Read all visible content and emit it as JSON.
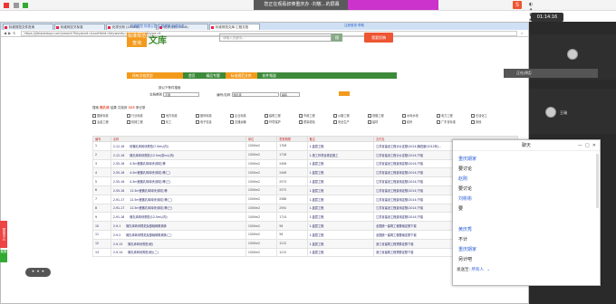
{
  "meeting": {
    "banner": "您正在观看叔俸重庆办 -刘敬...的屏幕",
    "timer": "01:14:16",
    "share_label": "演讲者视图",
    "speaking_label": "正在讲话:",
    "participants": [
      "任俊瑞",
      "王瑞"
    ]
  },
  "browser": {
    "tabs": [
      "标准规范文件查询",
      "标准网交叉标准",
      "化学分析 (2018年)",
      "化学分析 (2018)",
      "标准规范文库:工程文档"
    ],
    "url": "https://jibiaobiaoyi.com/search?Keyword=&sortfield=Keywords=kuanzhanzai&type=6",
    "site": {
      "logo_top": "标准规范",
      "logo_bottom": "查询",
      "logo_word": "文库",
      "search_placeholder": "请输入关键词...",
      "search_btn": "搜",
      "upload_btn": "我要投稿",
      "top_links": "标准规范  标准公告  工程规范  标准动态",
      "right_links": "注册登录  帮助",
      "nav": [
        "所有文档类型",
        "首页",
        "精品专题",
        "标准规范文库",
        "软件频道"
      ]
    },
    "filter": {
      "title": "按以下条件搜索",
      "label_type": "文档类别",
      "type_value": "不限",
      "label_code": "编号/名称",
      "code_value": "微孔砖",
      "label_scope": "搜索范围",
      "scope_value": "编码",
      "go": "搜索"
    },
    "result": {
      "prefix": "搜索",
      "keyword": "微孔砖",
      "mid": "结果 共找到",
      "count": "325",
      "suffix": "条记录"
    },
    "checks": [
      "国家标准",
      "行业标准",
      "地方标准",
      "团体标准",
      "企业标准",
      "建筑工程",
      "市政工程",
      "公路工程",
      "铁路工程",
      "水利水电",
      "电力工程",
      "石油化工",
      "冶金工程",
      "机械工程",
      "化工",
      "电子信息",
      "交通运输",
      "环境保护",
      "质量检验",
      "安全生产",
      "建材",
      "纺织",
      "广东省标准",
      "其他"
    ],
    "table_headers": [
      "编号",
      "名称",
      "单位",
      "签署期限",
      "备注",
      "文件名"
    ],
    "rows": [
      [
        "1",
        "2-12-16",
        "砼微孔砖砖块规范(7.5m以内)",
        "1000m2",
        "1706",
        "1.盖层工程",
        "江苏省建设工程计价定额(2014)第四册(2012年)..."
      ],
      [
        "2",
        "2-12-16",
        "微孔砖砖块规范(12.5m(前m以内)",
        "1000m2",
        "1718",
        "1.按工作项目规定施工",
        "江苏省建设工程计价定额(2014)下载"
      ],
      [
        "3",
        "2-55-16",
        "4.5m宽微孔砖砖块(抹灰)等",
        "1000m2",
        "2406",
        "1.盖层工程",
        "江苏省建设工程费用定额(2014)下载"
      ],
      [
        "4",
        "2-55-16",
        "4.5m宽微孔砖砖块(抹灰)等(二)",
        "1000m2",
        "2406",
        "1.盖层工程",
        "江苏省建设工程费用定额(2014)下载"
      ],
      [
        "5",
        "2-55-16",
        "4.5m宽微孔砖砖块(抹灰)等(三)",
        "1000m2",
        "2573",
        "1.盖层工程",
        "江苏省建设工程费用定额(2014)下载"
      ],
      [
        "6",
        "2-55-16",
        "12.5m宽微孔砖砖块(抹灰)等",
        "1000m2",
        "2572",
        "1.盖层工程",
        "江苏省建设工程费用定额(2014)下载"
      ],
      [
        "7",
        "2-91-17",
        "12.5m宽微孔砖砖块(抹灰)等(二)",
        "1000m2",
        "2588",
        "1.盖层工程",
        "江苏省建设工程费用定额(2014)下载"
      ],
      [
        "8",
        "2-91-17",
        "12.5m宽微孔砖砖块(抹灰)等(三)",
        "1000m2",
        "2592",
        "1.盖层工程",
        "江苏省建设工程费用定额(2014)下载"
      ],
      [
        "9",
        "2-91-18",
        "微孔砖砖块规范(12.5m以内)",
        "1000m2",
        "1714",
        "1.盖层工程",
        "江苏省建设工程费用定额(2014)下载"
      ],
      [
        "10",
        "2-9-1",
        "微孔砖砖块规范及基础砌筑墙体",
        "1000m2",
        "56",
        "1.盖层工程",
        "全国统一建筑工程基础定额下载"
      ],
      [
        "11",
        "2-9-2",
        "微孔砖砖块规范及基础砌筑墙体(二)",
        "1000m2",
        "56",
        "1.盖层工程",
        "全国统一建筑工程基础定额下载"
      ],
      [
        "12",
        "2-9-13",
        "微孔砖砖块规范(砼)",
        "1000m2",
        "1212",
        "1.盖层工程",
        "浙江省建筑工程预算定额下载"
      ],
      [
        "13",
        "2-9-14",
        "微孔砖砖块规范(砼)(二)",
        "1000m2",
        "1212",
        "1.盖层工程",
        "浙江省建筑工程预算定额下载"
      ]
    ]
  },
  "chat": {
    "title": "聊天",
    "messages": [
      {
        "name": "重庆期家",
        "text": "要讨论"
      },
      {
        "name": "赵刚",
        "text": "要讨论"
      },
      {
        "name": "刘彬彬",
        "text": "要"
      },
      {
        "name": "黄庆秀",
        "text": "不计"
      },
      {
        "name": "重庆期家",
        "text": "另计吧"
      }
    ],
    "send_to_label": "发送至:",
    "send_to_value": "所有人"
  },
  "left": {
    "badge1": "帮助中心",
    "badge2": "客服"
  }
}
